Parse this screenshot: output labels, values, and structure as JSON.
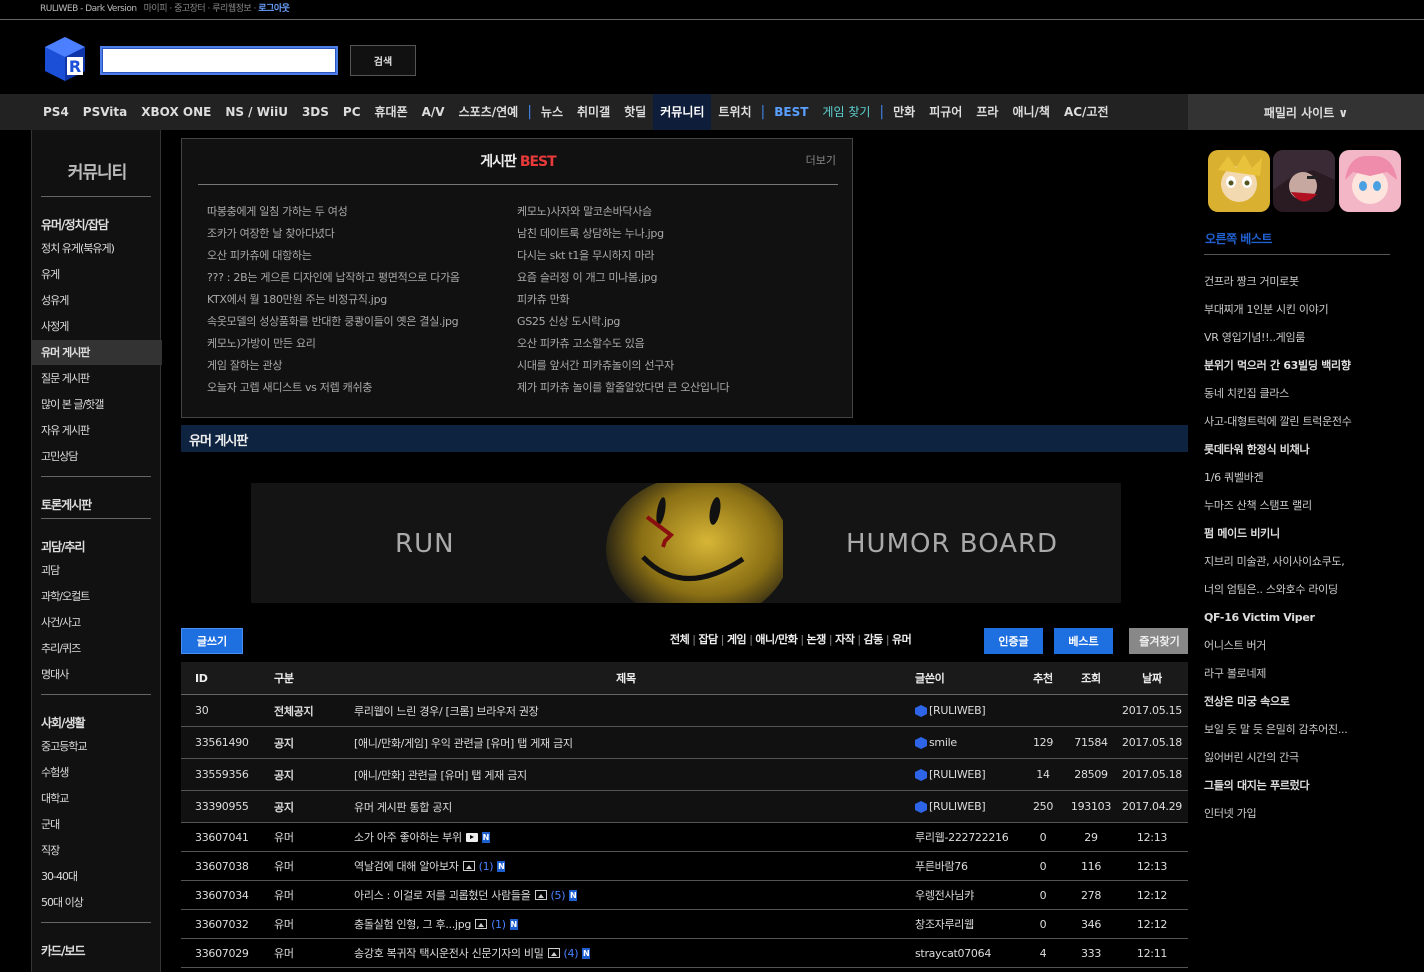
{
  "topbar": {
    "site": "RULIWEB - Dark Version",
    "links": "마이피 · 중고장터 · 루리웹정보 ·",
    "login": "로그아웃"
  },
  "search": {
    "placeholder": "",
    "button": "검색"
  },
  "nav": {
    "groups": [
      [
        "PS4",
        "PSVita",
        "XBOX ONE",
        "NS / WiiU",
        "3DS",
        "PC",
        "휴대폰",
        "A/V",
        "스포츠/연예"
      ],
      [
        "뉴스",
        "취미갤",
        "핫딜",
        "커뮤니티",
        "트위치"
      ],
      [
        "BEST",
        "게임 찾기"
      ],
      [
        "만화",
        "피규어",
        "프라",
        "애니/책",
        "AC/고전"
      ]
    ],
    "active": "커뮤니티",
    "family": "패밀리 사이트 ∨"
  },
  "sidebar": {
    "title": "커뮤니티",
    "sections": [
      {
        "heading": "유머/정치/잡담",
        "items": [
          "정치 유게(북유게)",
          "유게",
          "성유게",
          "사정게",
          "유머 게시판",
          "질문 게시판",
          "많이 본 글/핫갤",
          "자유 게시판",
          "고민상담"
        ]
      },
      {
        "heading": "토론게시판",
        "items": []
      },
      {
        "heading": "괴담/추리",
        "items": [
          "괴담",
          "과학/오컬트",
          "사건/사고",
          "추리/퀴즈",
          "명대사"
        ]
      },
      {
        "heading": "사회/생활",
        "items": [
          "중고등학교",
          "수험생",
          "대학교",
          "군대",
          "직장",
          "30-40대",
          "50대 이상"
        ]
      },
      {
        "heading": "카드/보드",
        "items": []
      }
    ],
    "active_item": "유머 게시판"
  },
  "best": {
    "title": "게시판",
    "title_accent": "BEST",
    "more": "더보기",
    "left": [
      "따봉충에게 일침 가하는 두 여성",
      "조카가 여장한 날 찾아다녔다",
      "오산 피카츄에 대항하는",
      "??? : 2B는 게으른 디자인에 납작하고 평면적으로 다가옴",
      "KTX에서 월 180만원 주는 비정규직.jpg",
      "속옷모델의 성상품화를 반대한 쿵쾅이들이 옛은 결실.jpg",
      "케모노)가방이 만든 요리",
      "게임 잘하는 관상",
      "오늘자 고렙 새디스트 vs 저렙 캐쉬충"
    ],
    "right": [
      "케모노)사자와 말코손바닥사슴",
      "남친 데이트룩 상담하는 누나.jpg",
      "다시는 skt t1을 무시하지 마라",
      "요즘 슬러정 이 개그 미나봄.jpg",
      "피카츄 만화",
      "GS25 신상 도시락.jpg",
      "오산 피카츄 고소할수도 있음",
      "시대를 앞서간 피카츄놀이의 선구자",
      "제가 피카츄 놀이를 할줄알았다면 큰 오산입니다"
    ]
  },
  "board": {
    "title": "유머 게시판",
    "banner_left": "RUN",
    "banner_right": "HUMOR BOARD",
    "write": "글쓰기",
    "filters": [
      "전체",
      "잡담",
      "게임",
      "애니/만화",
      "논쟁",
      "자작",
      "감동",
      "유머"
    ],
    "btn_cert": "인증글",
    "btn_best": "베스트",
    "btn_fav": "즐겨찾기",
    "headers": {
      "id": "ID",
      "cat": "구분",
      "title": "제목",
      "writer": "글쓴이",
      "rec": "추천",
      "view": "조회",
      "date": "날짜"
    },
    "notices": [
      {
        "id": "30",
        "cat": "전체공지",
        "title": "루리웹이 느린 경우/ [크롬] 브라우저 권장",
        "writer": "[RULIWEB]",
        "rec": "",
        "view": "",
        "date": "2017.05.15"
      },
      {
        "id": "33561490",
        "cat": "공지",
        "title": "[애니/만화/게임] 우익 관련글 [유머] 탭 게재 금지",
        "writer": "smile",
        "rec": "129",
        "view": "71584",
        "date": "2017.05.18"
      },
      {
        "id": "33559356",
        "cat": "공지",
        "title": "[애니/만화] 관련글 [유머] 탭 게재 금지",
        "writer": "[RULIWEB]",
        "rec": "14",
        "view": "28509",
        "date": "2017.05.18"
      },
      {
        "id": "33390955",
        "cat": "공지",
        "title": "유머 게시판 통합 공지",
        "writer": "[RULIWEB]",
        "rec": "250",
        "view": "193103",
        "date": "2017.04.29"
      }
    ],
    "posts": [
      {
        "id": "33607041",
        "cat": "유머",
        "title": "소가 아주 좋아하는 부위",
        "icon": "video",
        "comments": "",
        "writer": "루리웹-222722216",
        "rec": "0",
        "view": "29",
        "date": "12:13"
      },
      {
        "id": "33607038",
        "cat": "유머",
        "title": "역날검에 대해 알아보자",
        "icon": "image",
        "comments": "(1)",
        "writer": "푸른바람76",
        "rec": "0",
        "view": "116",
        "date": "12:13"
      },
      {
        "id": "33607034",
        "cat": "유머",
        "title": "아리스 : 이걸로 저를 괴롭혔던 사람들을",
        "icon": "image",
        "comments": "(5)",
        "writer": "우렝전사님캬",
        "rec": "0",
        "view": "278",
        "date": "12:12"
      },
      {
        "id": "33607032",
        "cat": "유머",
        "title": "충돌실험 인형, 그 후...jpg",
        "icon": "image",
        "comments": "(1)",
        "writer": "창조자루리웹",
        "rec": "0",
        "view": "346",
        "date": "12:12"
      },
      {
        "id": "33607029",
        "cat": "유머",
        "title": "송강호 복귀작 택시운전사 신문기자의 비밀",
        "icon": "image",
        "comments": "(4)",
        "writer": "straycat07064",
        "rec": "4",
        "view": "333",
        "date": "12:11"
      }
    ],
    "new_badge": "N"
  },
  "right": {
    "title": "오른쪽 베스트",
    "items": [
      {
        "text": "건프라 짱크 거미로봇",
        "bold": false
      },
      {
        "text": "부대찌개 1인분 시킨 이야기",
        "bold": false
      },
      {
        "text": "VR 영입기념!!..게임룸",
        "bold": false
      },
      {
        "text": "분위기 먹으러 간 63빌딩 백리향",
        "bold": true
      },
      {
        "text": "동네 치킨집 클라스",
        "bold": false
      },
      {
        "text": "사고-대형트럭에 깔린 트럭운전수",
        "bold": false
      },
      {
        "text": "롯데타워 한정식 비채나",
        "bold": true
      },
      {
        "text": "1/6 쿼벨바겐",
        "bold": false
      },
      {
        "text": "누마즈 산책 스탬프 랠리",
        "bold": false
      },
      {
        "text": "펌 메이드 비키니",
        "bold": true
      },
      {
        "text": "지브리 미술관, 사이사이쇼쿠도,",
        "bold": false
      },
      {
        "text": "너의 엄팀은.. 스와호수 라이딩",
        "bold": false
      },
      {
        "text": "QF-16 Victim Viper",
        "bold": true
      },
      {
        "text": "어니스트 버거",
        "bold": false
      },
      {
        "text": "라구 볼로네제",
        "bold": false
      },
      {
        "text": "전상은 미궁 속으로",
        "bold": true
      },
      {
        "text": "보일 듯 말 듯 은밀히 감추어진...",
        "bold": false
      },
      {
        "text": "잃어버린 시간의 간극",
        "bold": false
      },
      {
        "text": "그들의 대지는 푸르렀다",
        "bold": true
      },
      {
        "text": "인터넷 가입",
        "bold": false
      }
    ]
  }
}
